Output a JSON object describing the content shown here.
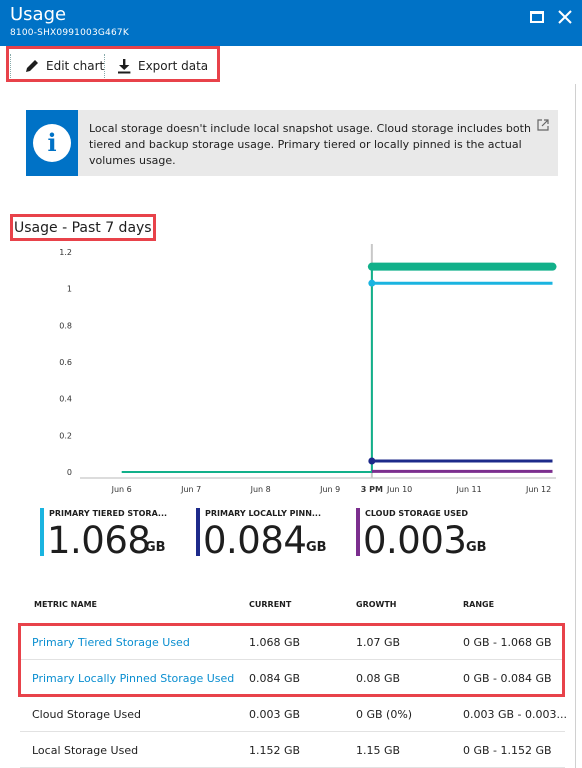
{
  "window": {
    "title": "Usage",
    "subtitle": "8100-SHX0991003G467K"
  },
  "toolbar": {
    "edit_label": "Edit chart",
    "export_label": "Export data"
  },
  "info": {
    "text": "Local storage doesn't include local snapshot usage.  Cloud storage includes both tiered and backup storage usage. Primary tiered or locally pinned is the actual volumes usage."
  },
  "section": {
    "title": "Usage - Past 7 days"
  },
  "chart_data": {
    "type": "line",
    "title": "",
    "xlabel": "",
    "ylabel": "",
    "ylim": [
      0,
      1.2
    ],
    "y_ticks": [
      "1.2",
      "1",
      "0.8",
      "0.6",
      "0.4",
      "0.2",
      "0"
    ],
    "x_ticks": [
      "Jun 6",
      "Jun 7",
      "Jun 8",
      "Jun 9",
      "3 PM",
      "Jun 10",
      "Jun 11",
      "Jun 12"
    ],
    "grid": false,
    "cursor_label": "3 PM",
    "series": [
      {
        "name": "Cloud storage used",
        "color": "#12b08a",
        "points": [
          [
            6.0,
            0.0
          ],
          [
            9.6,
            0.0
          ],
          [
            9.6,
            1.12
          ],
          [
            12.2,
            1.12
          ]
        ]
      },
      {
        "name": "Primary tiered storage used",
        "color": "#1ab4e0",
        "points": [
          [
            9.6,
            1.03
          ],
          [
            12.2,
            1.03
          ]
        ]
      },
      {
        "name": "Primary locally pinned storage used",
        "color": "#1d2a8a",
        "points": [
          [
            9.6,
            0.06
          ],
          [
            12.2,
            0.06
          ]
        ]
      },
      {
        "name": "Cloud storage used (line)",
        "color": "#7b2e8e",
        "points": [
          [
            9.6,
            0.003
          ],
          [
            12.2,
            0.003
          ]
        ]
      }
    ]
  },
  "legend": [
    {
      "name": "PRIMARY TIERED STORA...",
      "value": "1.068",
      "unit": "GB",
      "color": "#1ab4e0"
    },
    {
      "name": "PRIMARY LOCALLY PINN...",
      "value": "0.084",
      "unit": "GB",
      "color": "#1d2a8a"
    },
    {
      "name": "CLOUD STORAGE USED",
      "value": "0.003",
      "unit": "GB",
      "color": "#7b2e8e"
    }
  ],
  "table": {
    "headers": [
      "METRIC NAME",
      "CURRENT",
      "GROWTH",
      "RANGE"
    ],
    "rows": [
      [
        "Primary Tiered Storage Used",
        "1.068 GB",
        "1.07 GB",
        "0 GB - 1.068 GB"
      ],
      [
        "Primary Locally Pinned Storage Used",
        "0.084 GB",
        "0.08 GB",
        "0 GB - 0.084 GB"
      ],
      [
        "Cloud Storage Used",
        "0.003 GB",
        "0 GB (0%)",
        "0.003 GB - 0.003..."
      ],
      [
        "Local Storage Used",
        "1.152 GB",
        "1.15 GB",
        "0 GB - 1.152 GB"
      ]
    ]
  },
  "colors": {
    "titlebar": "#0072c6",
    "highlight": "#e8424a",
    "link": "#0a8ed0"
  }
}
